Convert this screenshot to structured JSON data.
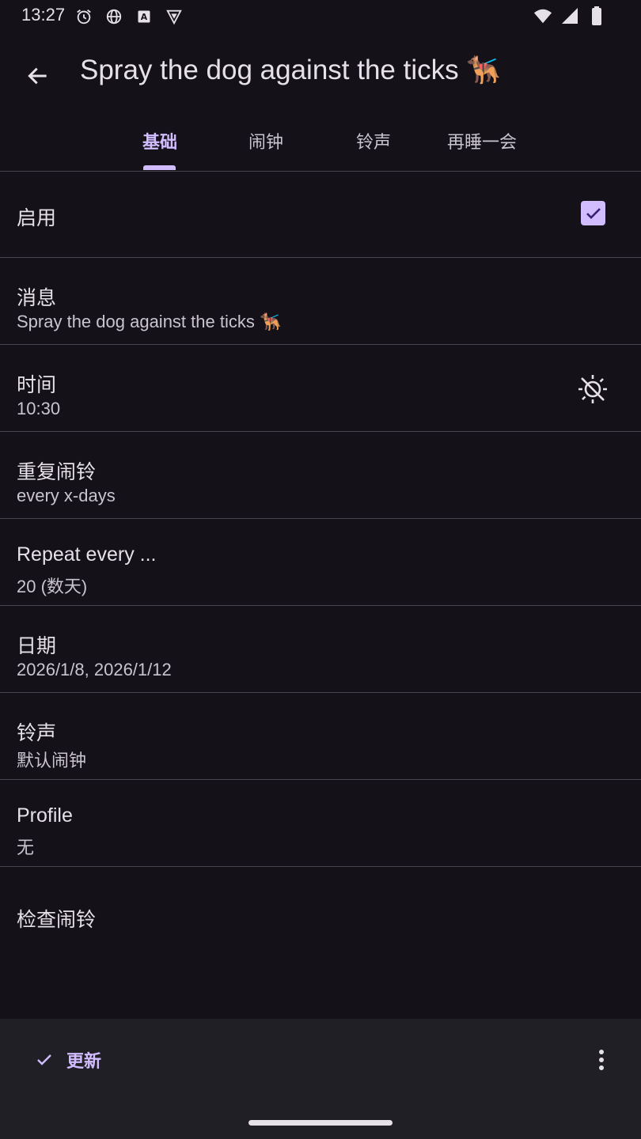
{
  "status_bar": {
    "time": "13:27",
    "icons_left": [
      "alarm-icon",
      "globe-icon",
      "a-square-icon",
      "vpn-shield-icon"
    ],
    "icons_right": [
      "wifi-icon",
      "cell-signal-icon",
      "battery-icon"
    ]
  },
  "app_bar": {
    "back_icon": "arrow-back-icon",
    "title": "Spray the dog against the ticks 🐕‍🦺"
  },
  "tabs": [
    {
      "label": "基础",
      "active": true
    },
    {
      "label": "闹钟",
      "active": false
    },
    {
      "label": "铃声",
      "active": false
    },
    {
      "label": "再睡一会",
      "active": false
    }
  ],
  "settings": {
    "enabled": {
      "label": "启用",
      "checked": true
    },
    "message": {
      "label": "消息",
      "value": "Spray the dog against the ticks 🐕‍🦺"
    },
    "time": {
      "label": "时间",
      "value": "10:30",
      "icon": "day-night-icon"
    },
    "repeat": {
      "label": "重复闹铃",
      "value": "every x-days"
    },
    "repeat_every": {
      "label": "Repeat every ...",
      "value": "20 (数天)"
    },
    "date": {
      "label": "日期",
      "value": "2026/1/8, 2026/1/12"
    },
    "ringtone": {
      "label": "铃声",
      "value": "默认闹钟"
    },
    "profile": {
      "label": "Profile",
      "value": "无"
    },
    "check_alarm": {
      "label": "检查闹铃"
    }
  },
  "bottom_bar": {
    "update_label": "更新",
    "update_icon": "check-icon",
    "more_icon": "more-vert-icon"
  },
  "colors": {
    "background": "#141218",
    "accent": "#d0bcff",
    "divider": "#49454f",
    "bottom_bar": "#211f26"
  }
}
